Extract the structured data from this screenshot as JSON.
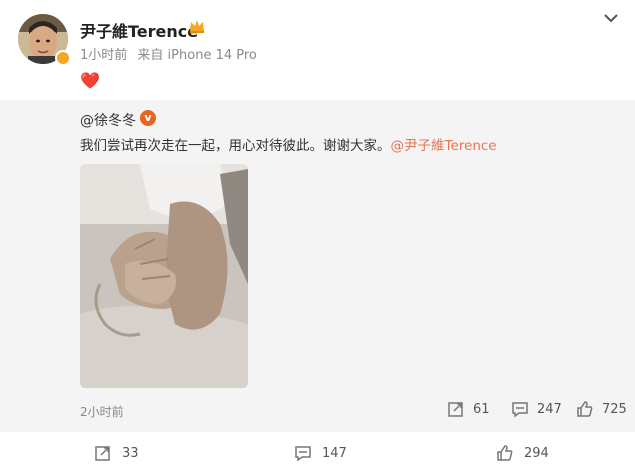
{
  "post": {
    "author": "尹子維Terence",
    "time": "1小时前",
    "source": "来自 iPhone 14 Pro",
    "body_emoji": "❤️"
  },
  "repost": {
    "author": "@徐冬冬",
    "verified_badge": "v",
    "text_before": "我们尝试再次走在一起，用心对待彼此。谢谢大家。",
    "mention": "@尹子維Terence",
    "time": "2小时前",
    "stats": {
      "shares": "61",
      "comments": "247",
      "likes": "725"
    }
  },
  "actions": {
    "shares": "33",
    "comments": "147",
    "likes": "294"
  },
  "colors": {
    "accent": "#eb7350",
    "heart": "#e0242d",
    "panel": "#f4f4f4"
  },
  "icons": [
    "crown-icon",
    "chevron-down-icon",
    "share-icon",
    "comment-icon",
    "like-icon"
  ]
}
